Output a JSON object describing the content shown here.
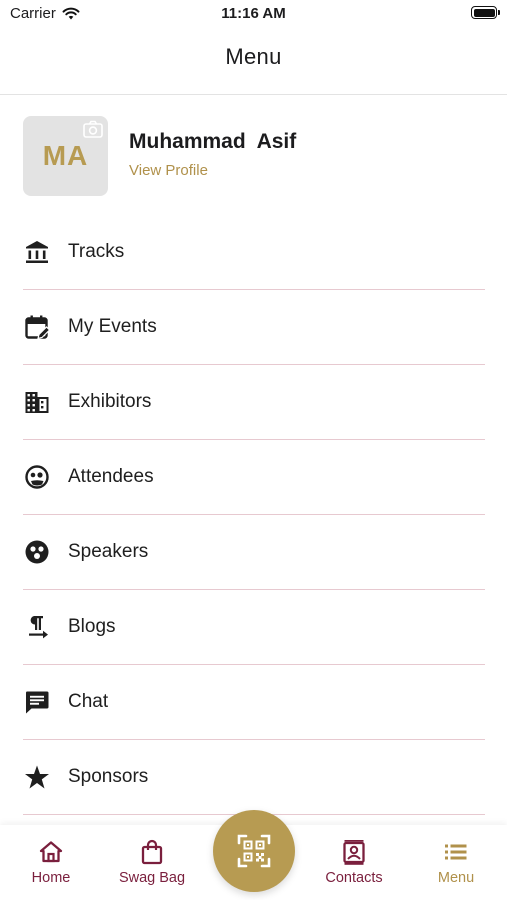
{
  "status_bar": {
    "carrier": "Carrier",
    "time": "11:16 AM"
  },
  "header": {
    "title": "Menu"
  },
  "profile": {
    "initials": "MA",
    "name": "Muhammad  Asif",
    "view_profile": "View Profile"
  },
  "menu": {
    "items": [
      {
        "label": "Tracks",
        "icon": "bank-icon"
      },
      {
        "label": "My Events",
        "icon": "calendar-edit-icon"
      },
      {
        "label": "Exhibitors",
        "icon": "building-icon"
      },
      {
        "label": "Attendees",
        "icon": "face-icon"
      },
      {
        "label": "Speakers",
        "icon": "speaker-face-icon"
      },
      {
        "label": "Blogs",
        "icon": "paragraph-icon"
      },
      {
        "label": "Chat",
        "icon": "chat-icon"
      },
      {
        "label": "Sponsors",
        "icon": "star-icon"
      }
    ]
  },
  "tab_bar": {
    "tabs": [
      {
        "label": "Home",
        "icon": "home-icon"
      },
      {
        "label": "Swag Bag",
        "icon": "bag-icon"
      },
      {
        "label": "Contacts",
        "icon": "contacts-icon"
      },
      {
        "label": "Menu",
        "icon": "menu-list-icon",
        "active": true
      }
    ],
    "center_action": {
      "icon": "qr-scan-icon"
    }
  },
  "colors": {
    "accent_gold": "#b79b52",
    "maroon": "#7a1f3d",
    "divider": "#e7c9d0",
    "avatar_bg": "#e3e3e3"
  }
}
